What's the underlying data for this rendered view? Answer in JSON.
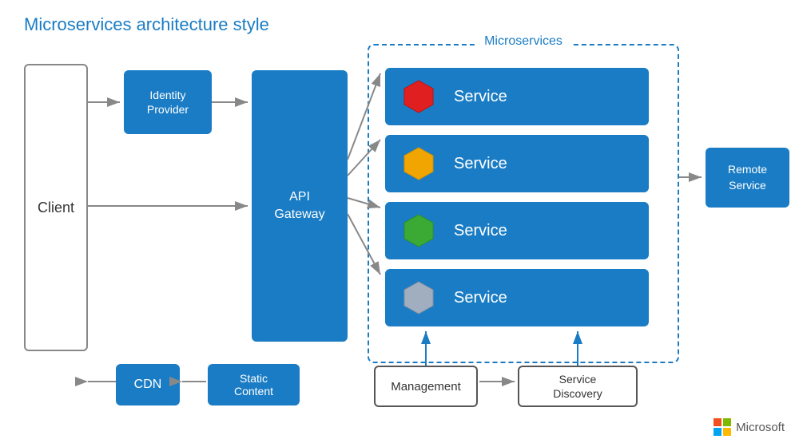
{
  "title": "Microservices architecture style",
  "client": {
    "label": "Client"
  },
  "identity": {
    "label": "Identity\nProvider",
    "line1": "Identity",
    "line2": "Provider"
  },
  "gateway": {
    "label": "API\nGateway",
    "line1": "API",
    "line2": "Gateway"
  },
  "microservices": {
    "title": "Microservices",
    "services": [
      {
        "label": "Service",
        "hex_color": "#e02020"
      },
      {
        "label": "Service",
        "hex_color": "#f0a500"
      },
      {
        "label": "Service",
        "hex_color": "#3aaa35"
      },
      {
        "label": "Service",
        "hex_color": "#a0aec0"
      }
    ]
  },
  "remote": {
    "line1": "Remote",
    "line2": "Service"
  },
  "cdn": {
    "label": "CDN"
  },
  "static_content": {
    "line1": "Static",
    "line2": "Content"
  },
  "management": {
    "label": "Management"
  },
  "discovery": {
    "line1": "Service",
    "line2": "Discovery"
  },
  "microsoft": {
    "label": "Microsoft"
  }
}
